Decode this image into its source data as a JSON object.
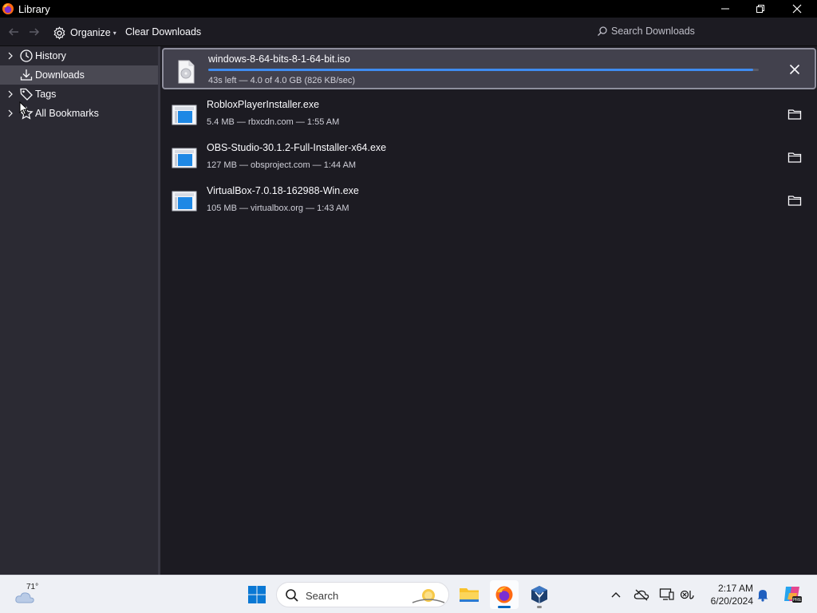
{
  "window": {
    "title": "Library"
  },
  "toolbar": {
    "organize_label": "Organize",
    "clear_downloads_label": "Clear Downloads",
    "search_placeholder": "Search Downloads"
  },
  "sidebar": {
    "items": [
      {
        "label": "History",
        "icon": "clock-icon",
        "expandable": true,
        "selected": false
      },
      {
        "label": "Downloads",
        "icon": "download-icon",
        "expandable": false,
        "selected": true
      },
      {
        "label": "Tags",
        "icon": "tag-icon",
        "expandable": true,
        "selected": false
      },
      {
        "label": "All Bookmarks",
        "icon": "star-icon",
        "expandable": true,
        "selected": false
      }
    ]
  },
  "downloads": {
    "active": {
      "name": "windows-8-64-bits-8-1-64-bit.iso",
      "status": "43s left — 4.0 of 4.0 GB (826 KB/sec)",
      "progress": 0.99
    },
    "completed": [
      {
        "name": "RobloxPlayerInstaller.exe",
        "meta": "5.4 MB — rbxcdn.com — 1:55 AM"
      },
      {
        "name": "OBS-Studio-30.1.2-Full-Installer-x64.exe",
        "meta": "127 MB — obsproject.com — 1:44 AM"
      },
      {
        "name": "VirtualBox-7.0.18-162988-Win.exe",
        "meta": "105 MB — virtualbox.org — 1:43 AM"
      }
    ]
  },
  "taskbar": {
    "weather_temp": "71°",
    "search_label": "Search",
    "clock_time": "2:17 AM",
    "clock_date": "6/20/2024"
  },
  "colors": {
    "accent": "#3f8cf1",
    "sidebar_bg": "#2b2a33",
    "main_bg": "#1c1b22",
    "active_item_bg": "#42414d"
  }
}
